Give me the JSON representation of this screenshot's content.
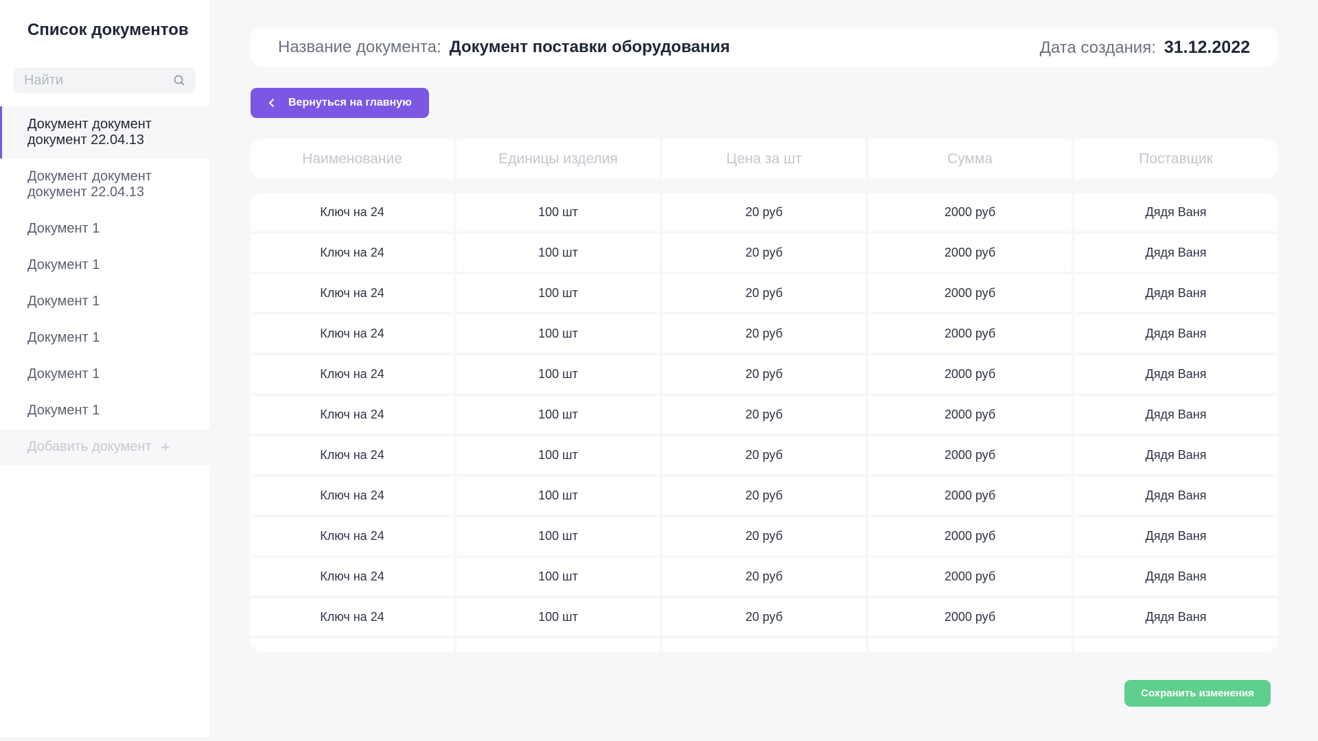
{
  "sidebar": {
    "title": "Список документов",
    "search_placeholder": "Найти",
    "documents": [
      {
        "label": "Документ документ документ 22.04.13",
        "active": true
      },
      {
        "label": "Документ документ документ 22.04.13",
        "active": false
      },
      {
        "label": "Документ 1",
        "active": false
      },
      {
        "label": "Документ 1",
        "active": false
      },
      {
        "label": "Документ 1",
        "active": false
      },
      {
        "label": "Документ 1",
        "active": false
      },
      {
        "label": "Документ 1",
        "active": false
      },
      {
        "label": "Документ 1",
        "active": false
      }
    ],
    "add_document_label": "Добавить документ",
    "add_icon": "plus-icon"
  },
  "header": {
    "name_label": "Название документа:",
    "name_value": "Документ поставки оборудования",
    "date_label": "Дата создания:",
    "date_value": "31.12.2022"
  },
  "back_button": {
    "label": "Вернуться на главную",
    "icon": "chevron-left-icon"
  },
  "table": {
    "columns": [
      "Наименование",
      "Единицы изделия",
      "Цена за шт",
      "Сумма",
      "Поставщик"
    ],
    "rows": [
      [
        "Ключ на 24",
        "100 шт",
        "20 руб",
        "2000 руб",
        "Дядя Ваня"
      ],
      [
        "Ключ на 24",
        "100 шт",
        "20 руб",
        "2000 руб",
        "Дядя Ваня"
      ],
      [
        "Ключ на 24",
        "100 шт",
        "20 руб",
        "2000 руб",
        "Дядя Ваня"
      ],
      [
        "Ключ на 24",
        "100 шт",
        "20 руб",
        "2000 руб",
        "Дядя Ваня"
      ],
      [
        "Ключ на 24",
        "100 шт",
        "20 руб",
        "2000 руб",
        "Дядя Ваня"
      ],
      [
        "Ключ на 24",
        "100 шт",
        "20 руб",
        "2000 руб",
        "Дядя Ваня"
      ],
      [
        "Ключ на 24",
        "100 шт",
        "20 руб",
        "2000 руб",
        "Дядя Ваня"
      ],
      [
        "Ключ на 24",
        "100 шт",
        "20 руб",
        "2000 руб",
        "Дядя Ваня"
      ],
      [
        "Ключ на 24",
        "100 шт",
        "20 руб",
        "2000 руб",
        "Дядя Ваня"
      ],
      [
        "Ключ на 24",
        "100 шт",
        "20 руб",
        "2000 руб",
        "Дядя Ваня"
      ],
      [
        "Ключ на 24",
        "100 шт",
        "20 руб",
        "2000 руб",
        "Дядя Ваня"
      ]
    ]
  },
  "save_button": {
    "label": "Сохранить изменения"
  },
  "colors": {
    "accent": "#7b57e4",
    "success": "#5fcf8d",
    "background": "#f7f7f9"
  }
}
